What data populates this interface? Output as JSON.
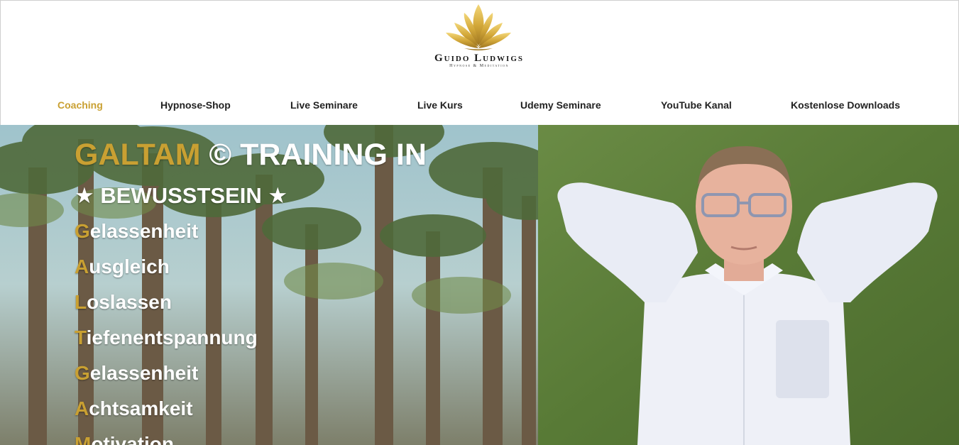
{
  "brand": {
    "name": "Guido Ludwigs",
    "tagline": "Hypnose & Meditation",
    "logo_icon": "lotus-icon",
    "accent_color": "#c9a032"
  },
  "nav": {
    "items": [
      {
        "label": "Coaching",
        "active": true
      },
      {
        "label": "Hypnose-Shop",
        "active": false
      },
      {
        "label": "Live Seminare",
        "active": false
      },
      {
        "label": "Live Kurs",
        "active": false
      },
      {
        "label": "Udemy Seminare",
        "active": false
      },
      {
        "label": "YouTube Kanal",
        "active": false
      },
      {
        "label": "Kostenlose Downloads",
        "active": false
      }
    ]
  },
  "hero": {
    "title_highlight": "GALTAM",
    "title_rest": " © TRAINING IN",
    "subtitle": "★ BEWUSSTSEIN ★",
    "words": [
      {
        "initial": "G",
        "rest": "elassenheit"
      },
      {
        "initial": "A",
        "rest": "usgleich"
      },
      {
        "initial": "L",
        "rest": "oslassen"
      },
      {
        "initial": "T",
        "rest": "iefenentspannung"
      },
      {
        "initial": "G",
        "rest": "elassenheit"
      },
      {
        "initial": "A",
        "rest": "chtsamkeit"
      },
      {
        "initial": "M",
        "rest": "otivation"
      }
    ]
  }
}
